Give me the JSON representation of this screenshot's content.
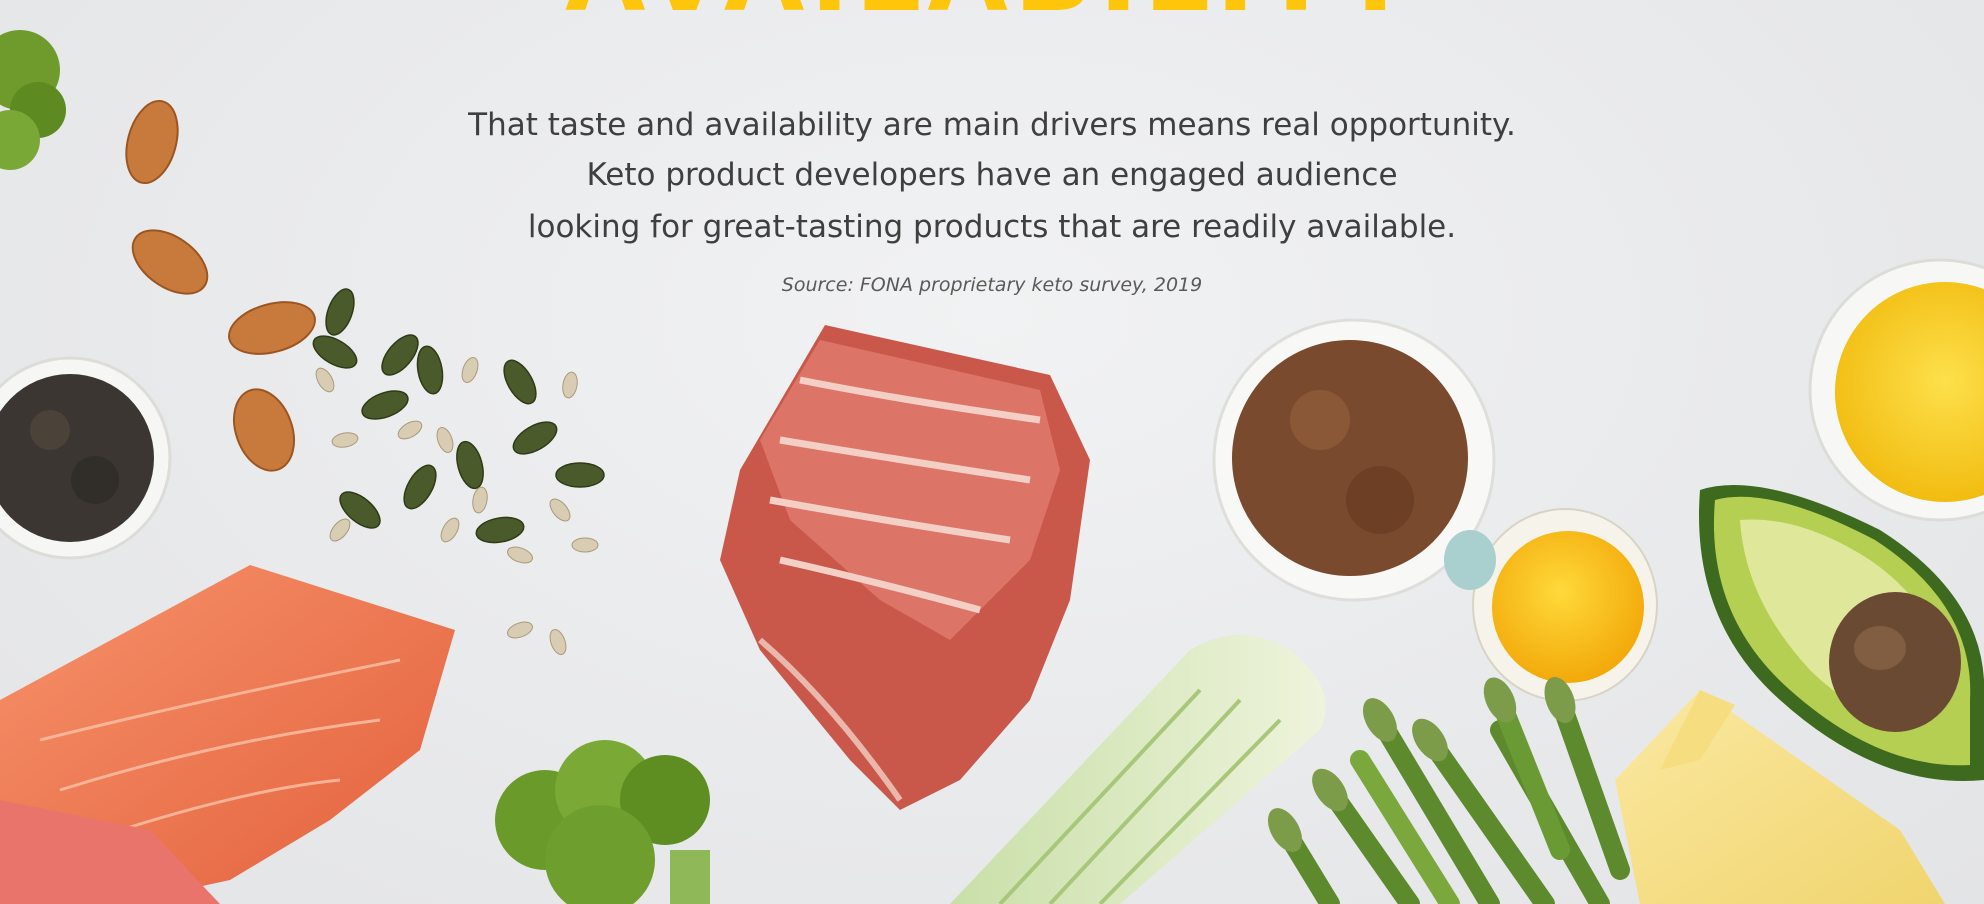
{
  "heading": {
    "text": "AVAILABILITY"
  },
  "body": {
    "lines": [
      "That taste and availability are main drivers means real opportunity.",
      "Keto product developers have an engaged audience",
      "looking for great-tasting products that are readily available."
    ]
  },
  "source": {
    "text": "Source: FONA proprietary keto survey, 2019"
  },
  "colors": {
    "heading": "#fdc50b",
    "text": "#3f3f3f",
    "background": "#e9eaec"
  }
}
